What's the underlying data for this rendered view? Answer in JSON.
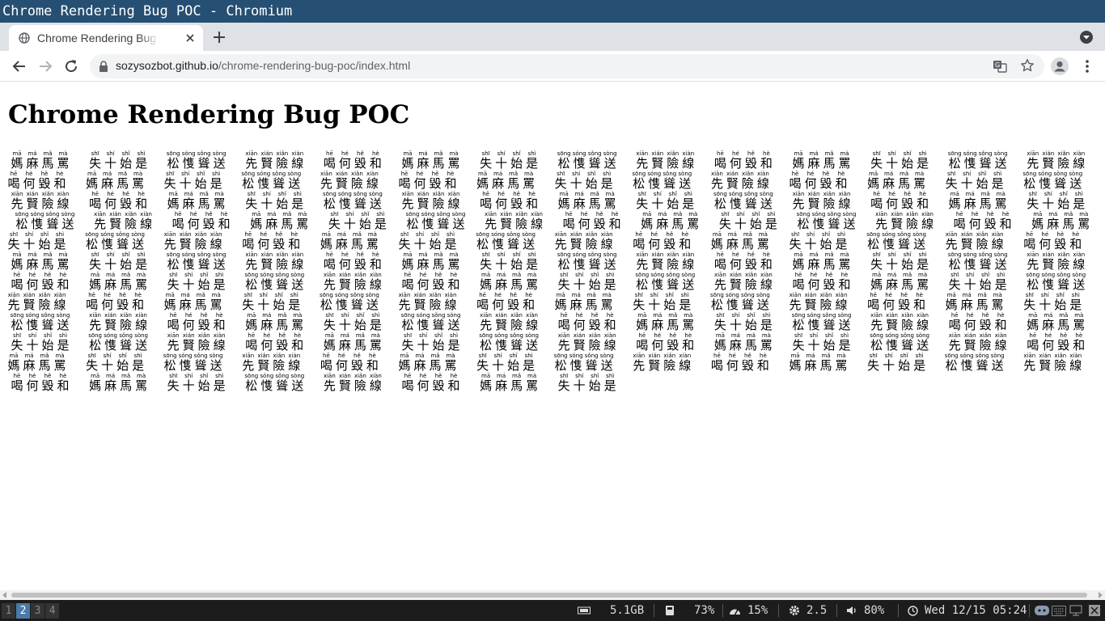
{
  "window": {
    "title": "Chrome Rendering Bug POC - Chromium"
  },
  "tab": {
    "title": "Chrome Rendering Bug POC"
  },
  "omnibox": {
    "host": "sozysozbot.github.io",
    "path": "/chrome-rendering-bug-poc/index.html"
  },
  "icons": {
    "favicon": "globe-icon",
    "close": "close-icon",
    "newtab": "plus-icon",
    "tabmenu": "chevron-down-circle-icon",
    "back": "arrow-left-icon",
    "forward": "arrow-right-icon",
    "reload": "reload-icon",
    "lock": "lock-icon",
    "translate": "translate-icon",
    "bookmark": "star-icon",
    "profile": "avatar-icon",
    "menu": "kebab-menu-icon"
  },
  "page": {
    "heading": "Chrome Rendering Bug POC",
    "groups": [
      {
        "hanzi": [
          "媽",
          "麻",
          "馬",
          "罵"
        ],
        "pinyin": [
          "mā",
          "má",
          "mǎ",
          "mà"
        ]
      },
      {
        "hanzi": [
          "失",
          "十",
          "始",
          "是"
        ],
        "pinyin": [
          "shī",
          "shí",
          "shǐ",
          "shì"
        ]
      },
      {
        "hanzi": [
          "松",
          "愯",
          "聳",
          "送"
        ],
        "pinyin": [
          "sōng",
          "sóng",
          "sǒng",
          "sòng"
        ]
      },
      {
        "hanzi": [
          "先",
          "賢",
          "險",
          "線"
        ],
        "pinyin": [
          "xiān",
          "xián",
          "xiǎn",
          "xiàn"
        ]
      },
      {
        "hanzi": [
          "喝",
          "何",
          "毀",
          "和"
        ],
        "pinyin": [
          "hē",
          "hé",
          "hě",
          "hè"
        ]
      }
    ]
  },
  "statusbar": {
    "workspaces": [
      "1",
      "2",
      "3",
      "4"
    ],
    "active_workspace": "2",
    "memory": "5.1GB",
    "disk": "73%",
    "cpu": "15%",
    "load": "2.5",
    "volume": "80%",
    "datetime": "Wed 12/15 05:24"
  },
  "colors": {
    "titlebar": "#254f73",
    "tabstrip": "#dee1e6",
    "statusbar": "#1c1c1c",
    "active_workspace": "#4a7aa8"
  }
}
